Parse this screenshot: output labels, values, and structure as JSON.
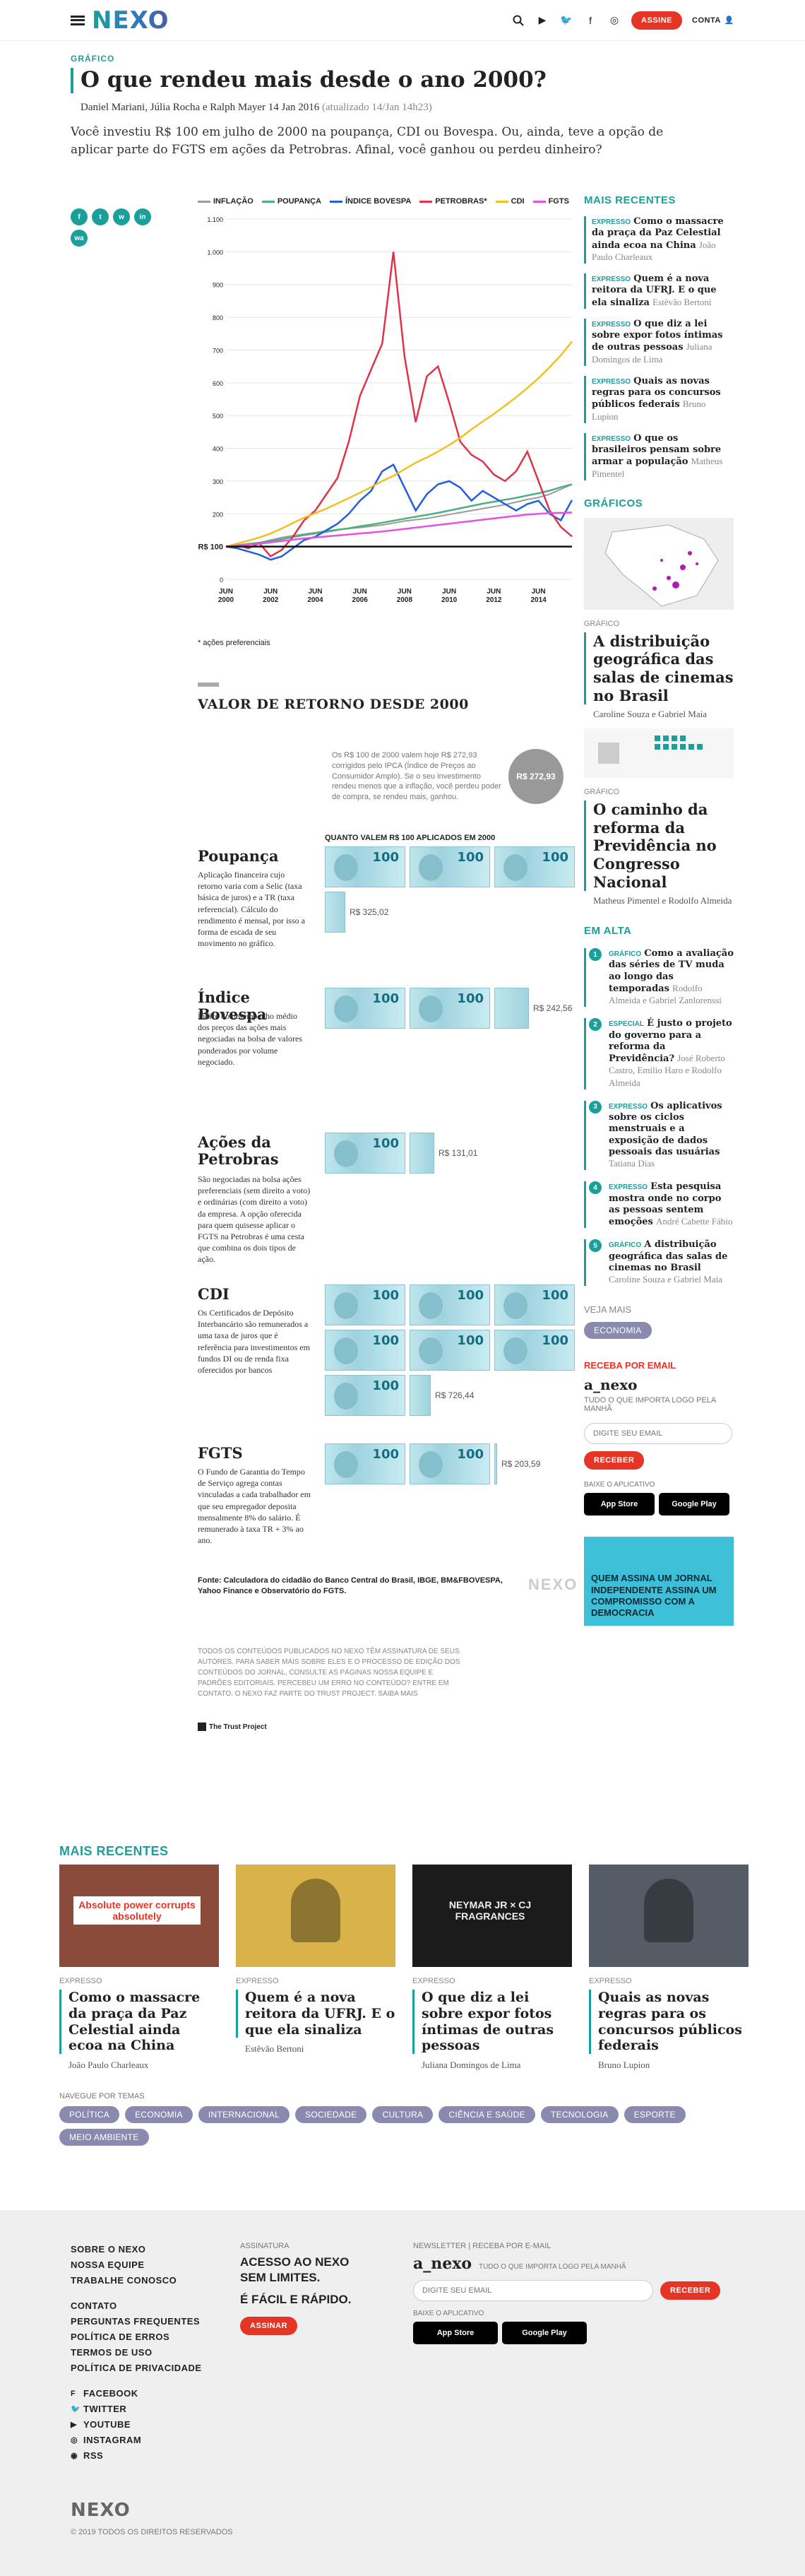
{
  "header": {
    "logo": "NEXO",
    "subscribe": "ASSINE",
    "account": "CONTA"
  },
  "article": {
    "kicker": "GRÁFICO",
    "title": "O que rendeu mais desde o ano 2000?",
    "authors": "Daniel Mariani, Júlia Rocha e Ralph Mayer",
    "date": "14 Jan 2016",
    "updated": "(atualizado 14/Jan 14h23)",
    "lede": "Você investiu R$ 100 em julho de 2000 na poupança, CDI ou Bovespa. Ou, ainda, teve a opção de aplicar parte do FGTS em ações da Petrobras. Afinal, você ganhou ou perdeu dinheiro?"
  },
  "share": [
    "f",
    "t",
    "w",
    "in",
    "wa"
  ],
  "chart_data": {
    "type": "line",
    "title": "",
    "xlabel": "",
    "ylabel": "",
    "ylim": [
      0,
      1100
    ],
    "yticks": [
      0,
      100,
      200,
      300,
      400,
      500,
      600,
      700,
      800,
      900,
      1000,
      1100
    ],
    "ytick_labels": [
      "0",
      "R$ 100",
      "200",
      "300",
      "400",
      "500",
      "600",
      "700",
      "800",
      "900",
      "1.000",
      "1.100"
    ],
    "xticks": [
      "JUN 2000",
      "JUN 2002",
      "JUN 2004",
      "JUN 2006",
      "JUN 2008",
      "JUN 2010",
      "JUN 2012",
      "JUN 2014"
    ],
    "x": [
      2000.5,
      2001,
      2001.5,
      2002,
      2002.5,
      2003,
      2003.5,
      2004,
      2004.5,
      2005,
      2005.5,
      2006,
      2006.5,
      2007,
      2007.5,
      2008,
      2008.5,
      2009,
      2009.5,
      2010,
      2010.5,
      2011,
      2011.5,
      2012,
      2012.5,
      2013,
      2013.5,
      2014,
      2014.5,
      2015,
      2015.5,
      2016
    ],
    "series": [
      {
        "name": "INFLAÇÃO",
        "color": "#9b9b9b",
        "values": [
          100,
          104,
          108,
          112,
          120,
          128,
          133,
          138,
          143,
          148,
          152,
          155,
          158,
          162,
          166,
          172,
          178,
          182,
          186,
          192,
          198,
          204,
          210,
          216,
          222,
          228,
          236,
          244,
          250,
          260,
          275,
          290
        ]
      },
      {
        "name": "POUPANÇA",
        "color": "#4caf7d",
        "values": [
          100,
          104,
          108,
          112,
          117,
          123,
          129,
          135,
          140,
          145,
          151,
          156,
          162,
          167,
          173,
          179,
          185,
          191,
          197,
          203,
          210,
          217,
          224,
          231,
          237,
          243,
          249,
          256,
          263,
          271,
          281,
          290
        ]
      },
      {
        "name": "ÍNDICE BOVESPA",
        "color": "#1f5fe0",
        "values": [
          100,
          95,
          85,
          75,
          60,
          70,
          95,
          120,
          130,
          150,
          170,
          200,
          240,
          270,
          330,
          350,
          280,
          210,
          260,
          290,
          300,
          280,
          240,
          270,
          250,
          230,
          210,
          230,
          240,
          200,
          180,
          242
        ]
      },
      {
        "name": "PETROBRAS*",
        "color": "#e0334a",
        "values": [
          100,
          105,
          95,
          110,
          70,
          90,
          130,
          180,
          210,
          260,
          310,
          420,
          560,
          640,
          720,
          1000,
          680,
          480,
          620,
          650,
          540,
          420,
          380,
          360,
          320,
          300,
          330,
          390,
          300,
          210,
          160,
          131
        ]
      },
      {
        "name": "CDI",
        "color": "#f0c020",
        "values": [
          100,
          109,
          118,
          128,
          140,
          155,
          172,
          188,
          202,
          216,
          232,
          248,
          264,
          282,
          300,
          316,
          336,
          356,
          372,
          390,
          410,
          432,
          458,
          482,
          505,
          530,
          556,
          584,
          614,
          648,
          684,
          726
        ]
      },
      {
        "name": "FGTS",
        "color": "#e650e6",
        "values": [
          100,
          103,
          106,
          109,
          113,
          117,
          121,
          125,
          128,
          131,
          134,
          137,
          140,
          143,
          146,
          150,
          154,
          158,
          162,
          166,
          170,
          174,
          178,
          182,
          186,
          190,
          194,
          198,
          200,
          202,
          203,
          204
        ]
      }
    ],
    "baseline_label": "R$ 100",
    "note": "* ações preferenciais"
  },
  "returns": {
    "title": "VALOR DE RETORNO DESDE 2000",
    "inflation_note": "Os R$ 100 de 2000 valem hoje R$ 272,93 corrigidos pelo IPCA (Índice de Preços ao Consumidor Amplo). Se o seu investimento rendeu menos que a inflação, você perdeu poder de compra, se rendeu mais, ganhou.",
    "inflation_value": "R$ 272,93",
    "subheading": "QUANTO VALEM R$ 100 APLICADOS EM 2000",
    "items": [
      {
        "name": "Poupança",
        "desc": "Aplicação financeira cujo retorno varia com a Selic (taxa básica de juros) e a TR (taxa referencial). Cálculo do rendimento é mensal, por isso a forma de escada de seu movimento no gráfico.",
        "value": "R$ 325,02",
        "v": 325.02
      },
      {
        "name": "Índice Bovespa",
        "desc": "Índice do desempenho médio dos preços das ações mais negociadas na bolsa de valores ponderados por volume negociado.",
        "value": "R$ 242,56",
        "v": 242.56
      },
      {
        "name": "Ações da Petrobras",
        "desc": "São negociadas na bolsa ações preferenciais (sem direito a voto) e ordinárias (com direito a voto) da empresa. A opção oferecida para quem quisesse aplicar o FGTS na Petrobras é uma cesta que combina os dois tipos de ação.",
        "value": "R$ 131,01",
        "v": 131.01
      },
      {
        "name": "CDI",
        "desc": "Os Certificados de Depósito Interbancário são remunerados a uma taxa de juros que é referência para investimentos em fundos DI ou de renda fixa oferecidos por bancos",
        "value": "R$ 726,44",
        "v": 726.44
      },
      {
        "name": "FGTS",
        "desc": "O Fundo de Garantia do Tempo de Serviço agrega contas vinculadas a cada trabalhador em que seu empregador deposita mensalmente 8% do salário. É remunerado à taxa TR + 3% ao ano.",
        "value": "R$ 203,59",
        "v": 203.59
      }
    ],
    "source": "Fonte: Calculadora do cidadão do Banco Central do Brasil, IBGE, BM&FBOVESPA, Yahoo Finance e Observatório do FGTS.",
    "watermark": "NEXO"
  },
  "rights": {
    "text": "TODOS OS CONTEÚDOS PUBLICADOS NO NEXO TÊM ASSINATURA DE SEUS AUTORES. PARA SABER MAIS SOBRE ELES E O PROCESSO DE EDIÇÃO DOS CONTEÚDOS DO JORNAL, CONSULTE AS PÁGINAS NOSSA EQUIPE E PADRÕES EDITORIAIS. PERCEBEU UM ERRO NO CONTEÚDO? ENTRE EM CONTATO. O NEXO FAZ PARTE DO TRUST PROJECT. SAIBA MAIS",
    "trust": "The Trust Project"
  },
  "sidebar": {
    "recent_title": "MAIS RECENTES",
    "recent": [
      {
        "k": "EXPRESSO",
        "t": "Como o massacre da praça da Paz Celestial ainda ecoa na China",
        "a": "João Paulo Charleaux"
      },
      {
        "k": "EXPRESSO",
        "t": "Quem é a nova reitora da UFRJ. E o que ela sinaliza",
        "a": "Estêvão Bertoni"
      },
      {
        "k": "EXPRESSO",
        "t": "O que diz a lei sobre expor fotos íntimas de outras pessoas",
        "a": "Juliana Domingos de Lima"
      },
      {
        "k": "EXPRESSO",
        "t": "Quais as novas regras para os concursos públicos federais",
        "a": "Bruno Lupion"
      },
      {
        "k": "EXPRESSO",
        "t": "O que os brasileiros pensam sobre armar a população",
        "a": "Matheus Pimentel"
      }
    ],
    "graphics_title": "GRÁFICOS",
    "graphics": [
      {
        "k": "GRÁFICO",
        "t": "A distribuição geográfica das salas de cinemas no Brasil",
        "a": "Caroline Souza e Gabriel Maia"
      },
      {
        "k": "GRÁFICO",
        "t": "O caminho da reforma da Previdência no Congresso Nacional",
        "a": "Matheus Pimentel e Rodolfo Almeida"
      }
    ],
    "trending_title": "EM ALTA",
    "trending": [
      {
        "n": "1",
        "k": "GRÁFICO",
        "t": "Como a avaliação das séries de TV muda ao longo das temporadas",
        "a": "Rodolfo Almeida e Gabriel Zanlorenssi"
      },
      {
        "n": "2",
        "k": "ESPECIAL",
        "t": "É justo o projeto do governo para a reforma da Previdência?",
        "a": "José Roberto Castro, Emilio Haro e Rodolfo Almeida"
      },
      {
        "n": "3",
        "k": "EXPRESSO",
        "t": "Os aplicativos sobre os ciclos menstruais e a exposição de dados pessoais das usuárias",
        "a": "Tatiana Dias"
      },
      {
        "n": "4",
        "k": "EXPRESSO",
        "t": "Esta pesquisa mostra onde no corpo as pessoas sentem emoções",
        "a": "André Cabette Fábio"
      },
      {
        "n": "5",
        "k": "GRÁFICO",
        "t": "A distribuição geográfica das salas de cinemas no Brasil",
        "a": "Caroline Souza e Gabriel Maia"
      }
    ],
    "see_more": "VEJA MAIS",
    "see_more_tag": "ECONOMIA",
    "email_title": "RECEBA POR EMAIL",
    "anexo": "a_nexo",
    "anexo_desc": "TUDO O QUE IMPORTA LOGO PELA MANHÃ",
    "email_placeholder": "DIGITE SEU EMAIL",
    "receive": "RECEBER",
    "app_title": "BAIXE O APLICATIVO",
    "appstore": "App Store",
    "playstore": "Google Play",
    "promo": "QUEM ASSINA UM JORNAL INDEPENDENTE ASSINA UM COMPROMISSO COM A DEMOCRACIA"
  },
  "bottom": {
    "title": "MAIS RECENTES",
    "items": [
      {
        "k": "EXPRESSO",
        "t": "Como o massacre da praça da Paz Celestial ainda ecoa na China",
        "a": "João Paulo Charleaux",
        "sign": "Absolute power corrupts absolutely"
      },
      {
        "k": "EXPRESSO",
        "t": "Quem é a nova reitora da UFRJ. E o que ela sinaliza",
        "a": "Estêvão Bertoni",
        "sign": ""
      },
      {
        "k": "EXPRESSO",
        "t": "O que diz a lei sobre expor fotos íntimas de outras pessoas",
        "a": "Juliana Domingos de Lima",
        "sign": "NEYMAR JR × CJ FRAGRANCES"
      },
      {
        "k": "EXPRESSO",
        "t": "Quais as novas regras para os concursos públicos federais",
        "a": "Bruno Lupion",
        "sign": ""
      }
    ],
    "topics_title": "NAVEGUE POR TEMAS",
    "topics": [
      "POLÍTICA",
      "ECONOMIA",
      "INTERNACIONAL",
      "SOCIEDADE",
      "CULTURA",
      "CIÊNCIA E SAÚDE",
      "TECNOLOGIA",
      "ESPORTE",
      "MEIO AMBIENTE"
    ]
  },
  "footer": {
    "links1": [
      "SOBRE O NEXO",
      "NOSSA EQUIPE",
      "TRABALHE CONOSCO"
    ],
    "links2": [
      "CONTATO",
      "PERGUNTAS FREQUENTES",
      "POLÍTICA DE ERROS",
      "TERMOS DE USO",
      "POLÍTICA DE PRIVACIDADE"
    ],
    "social": [
      "FACEBOOK",
      "TWITTER",
      "YOUTUBE",
      "INSTAGRAM",
      "RSS"
    ],
    "sub_label": "ASSINATURA",
    "sub_text": "ACESSO AO NEXO SEM LIMITES.",
    "sub_text2": "É FÁCIL E RÁPIDO.",
    "sub_btn": "ASSINAR",
    "news_label": "NEWSLETTER | RECEBA POR E-MAIL",
    "anexo": "a_nexo",
    "anexo_desc": "TUDO O QUE IMPORTA LOGO PELA MANHÃ",
    "email_placeholder": "DIGITE SEU EMAIL",
    "receive": "RECEBER",
    "app_label": "BAIXE O APLICATIVO",
    "appstore": "App Store",
    "playstore": "Google Play",
    "logo": "NEXO",
    "copyright": "© 2019 TODOS OS DIREITOS RESERVADOS"
  }
}
